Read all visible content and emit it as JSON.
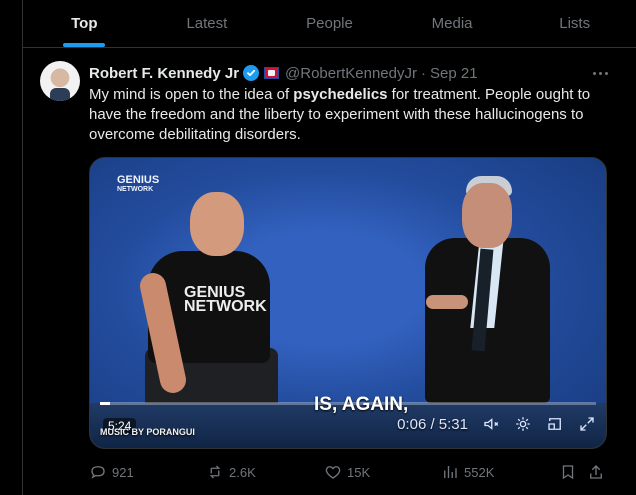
{
  "tabs": [
    {
      "label": "Top",
      "active": true
    },
    {
      "label": "Latest",
      "active": false
    },
    {
      "label": "People",
      "active": false
    },
    {
      "label": "Media",
      "active": false
    },
    {
      "label": "Lists",
      "active": false
    }
  ],
  "post": {
    "author_name": "Robert F. Kennedy Jr",
    "handle": "@RobertKennedyJr",
    "separator": "·",
    "date": "Sep 21",
    "text_before": "My mind is open to the idea of ",
    "text_bold": "psychedelics",
    "text_after": " for treatment. People ought to have the freedom and the liberty to experiment with these hallucinogens to overcome debilitating disorders.",
    "video": {
      "brand_top": "GENIUS",
      "brand_bottom": "NETWORK",
      "shirt_line1": "GENIUS",
      "shirt_line2": "NETWORK",
      "caption": "IS, AGAIN,",
      "duration_badge": "5:24",
      "music_credit": "MUSIC BY PORANGUI",
      "player_time": "0:06 / 5:31",
      "progress_fraction": 0.02
    },
    "actions": {
      "replies": "921",
      "reposts": "2.6K",
      "likes": "15K",
      "views": "552K"
    }
  },
  "colors": {
    "background": "#000000",
    "accent": "#1d9bf0",
    "muted_text": "#71767b",
    "video_blue": "#244c9f"
  },
  "icons": {
    "verified": "verified-badge-icon",
    "more": "more-horizontal-icon",
    "reply": "reply-icon",
    "repost": "repost-icon",
    "like": "like-icon",
    "views": "views-icon",
    "bookmark": "bookmark-icon",
    "share": "share-icon",
    "mute": "mute-icon",
    "settings": "settings-icon",
    "pip": "picture-in-picture-icon",
    "fullscreen": "fullscreen-icon"
  }
}
